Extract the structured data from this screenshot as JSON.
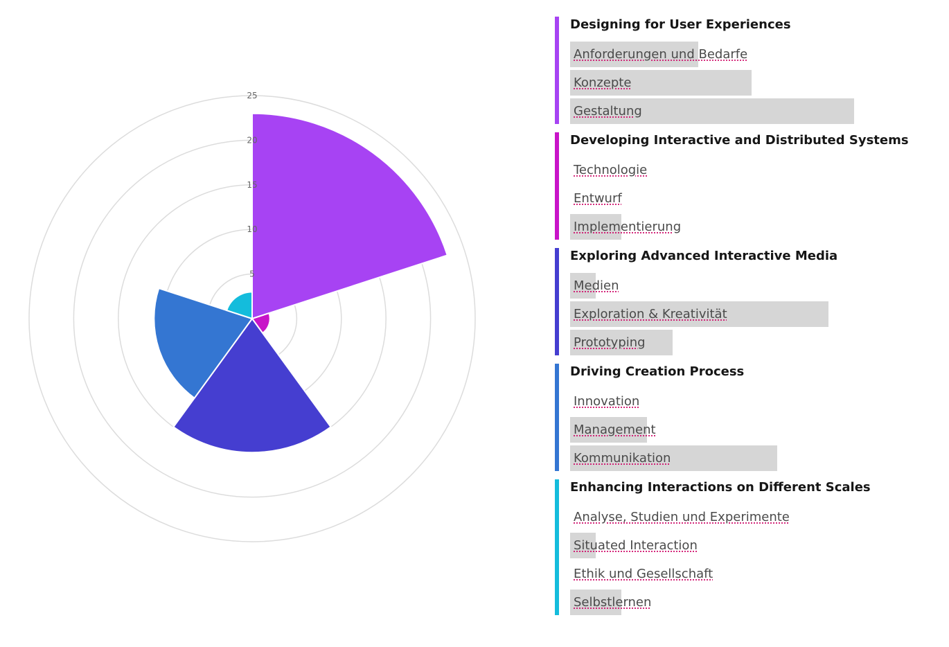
{
  "chart_data": {
    "type": "polar-area",
    "radial_axis": {
      "max": 25,
      "ticks": [
        5,
        10,
        15,
        20,
        25
      ],
      "tick_labels": [
        "5",
        "10",
        "15",
        "20",
        "25"
      ]
    },
    "grid": true,
    "sectors": [
      {
        "group": "Designing for User Experiences",
        "value": 23.0,
        "color": "#a743f3"
      },
      {
        "group": "Developing Interactive and Distributed Systems",
        "value": 2.0,
        "color": "#c814c8"
      },
      {
        "group": "Exploring Advanced Interactive Media",
        "value": 15.0,
        "color": "#453ed0"
      },
      {
        "group": "Driving Creation Process",
        "value": 11.0,
        "color": "#3476d2"
      },
      {
        "group": "Enhancing Interactions on Different Scales",
        "value": 3.0,
        "color": "#14bcdc"
      }
    ]
  },
  "legend": {
    "groups": [
      {
        "title": "Designing for User Experiences",
        "color": "#a743f3",
        "items": [
          {
            "label": "Anforderungen und Bedarfe",
            "level": 0.45
          },
          {
            "label": "Konzepte",
            "level": 0.64
          },
          {
            "label": "Gestaltung",
            "level": 1.0
          }
        ]
      },
      {
        "title": "Developing Interactive and Distributed Systems",
        "color": "#c814c8",
        "items": [
          {
            "label": "Technologie",
            "level": 0
          },
          {
            "label": "Entwurf",
            "level": 0
          },
          {
            "label": "Implementierung",
            "level": 0.18
          }
        ]
      },
      {
        "title": "Exploring Advanced Interactive Media",
        "color": "#453ed0",
        "items": [
          {
            "label": "Medien",
            "level": 0.09
          },
          {
            "label": "Exploration & Kreativität",
            "level": 0.91
          },
          {
            "label": "Prototyping",
            "level": 0.36
          }
        ]
      },
      {
        "title": "Driving Creation Process",
        "color": "#3476d2",
        "items": [
          {
            "label": "Innovation",
            "level": 0
          },
          {
            "label": "Management",
            "level": 0.27
          },
          {
            "label": "Kommunikation",
            "level": 0.73
          }
        ]
      },
      {
        "title": "Enhancing Interactions on Different Scales",
        "color": "#14bcdc",
        "items": [
          {
            "label": "Analyse, Studien und Experimente",
            "level": 0
          },
          {
            "label": "Situated Interaction",
            "level": 0.09
          },
          {
            "label": "Ethik und Gesellschaft",
            "level": 0
          },
          {
            "label": "Selbstlernen",
            "level": 0.18
          }
        ]
      }
    ]
  }
}
